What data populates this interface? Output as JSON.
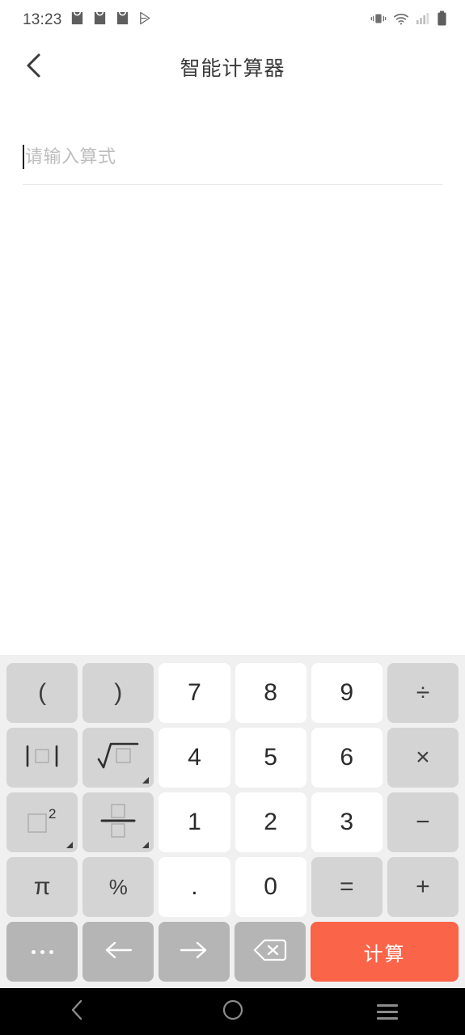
{
  "statusbar": {
    "clock": "13:23",
    "left_icons": [
      "mail-icon",
      "mail-icon",
      "mail-icon",
      "play-store-icon"
    ],
    "right_icons": [
      "vibrate-icon",
      "wifi-icon",
      "signal-bars-icon",
      "battery-icon"
    ]
  },
  "appbar": {
    "back_icon": "chevron-left-icon",
    "title": "智能计算器"
  },
  "input": {
    "value": "",
    "placeholder": "请输入算式"
  },
  "colors": {
    "accent": "#fa6449",
    "function_key": "#d4d4d4",
    "number_key": "#ffffff",
    "util_key": "#b5b5b5",
    "keypad_bg": "#f0f0f0",
    "navbar_bg": "#000000"
  },
  "keypad": {
    "rows": [
      [
        {
          "name": "key-open-paren",
          "label": "(",
          "type": "fn",
          "glyph": "text"
        },
        {
          "name": "key-close-paren",
          "label": ")",
          "type": "fn",
          "glyph": "text"
        },
        {
          "name": "key-7",
          "label": "7",
          "type": "num",
          "glyph": "text"
        },
        {
          "name": "key-8",
          "label": "8",
          "type": "num",
          "glyph": "text"
        },
        {
          "name": "key-9",
          "label": "9",
          "type": "num",
          "glyph": "text"
        },
        {
          "name": "key-divide",
          "label": "÷",
          "type": "fn",
          "glyph": "text"
        }
      ],
      [
        {
          "name": "key-absolute-value",
          "label": "|□|",
          "type": "fn",
          "glyph": "abs"
        },
        {
          "name": "key-square-root",
          "label": "√□",
          "type": "fn",
          "glyph": "sqrt",
          "more": true
        },
        {
          "name": "key-4",
          "label": "4",
          "type": "num",
          "glyph": "text"
        },
        {
          "name": "key-5",
          "label": "5",
          "type": "num",
          "glyph": "text"
        },
        {
          "name": "key-6",
          "label": "6",
          "type": "num",
          "glyph": "text"
        },
        {
          "name": "key-multiply",
          "label": "×",
          "type": "fn",
          "glyph": "text"
        }
      ],
      [
        {
          "name": "key-square",
          "label": "□²",
          "type": "fn",
          "glyph": "square",
          "more": true
        },
        {
          "name": "key-fraction",
          "label": "□/□",
          "type": "fn",
          "glyph": "fraction",
          "more": true
        },
        {
          "name": "key-1",
          "label": "1",
          "type": "num",
          "glyph": "text"
        },
        {
          "name": "key-2",
          "label": "2",
          "type": "num",
          "glyph": "text"
        },
        {
          "name": "key-3",
          "label": "3",
          "type": "num",
          "glyph": "text"
        },
        {
          "name": "key-minus",
          "label": "−",
          "type": "fn",
          "glyph": "text"
        }
      ],
      [
        {
          "name": "key-pi",
          "label": "π",
          "type": "fn",
          "glyph": "text"
        },
        {
          "name": "key-percent",
          "label": "%",
          "type": "fn",
          "glyph": "text"
        },
        {
          "name": "key-decimal",
          "label": ".",
          "type": "num",
          "glyph": "text"
        },
        {
          "name": "key-0",
          "label": "0",
          "type": "num",
          "glyph": "text"
        },
        {
          "name": "key-equals",
          "label": "=",
          "type": "fn",
          "glyph": "text"
        },
        {
          "name": "key-plus",
          "label": "+",
          "type": "fn",
          "glyph": "text"
        }
      ],
      [
        {
          "name": "key-more",
          "label": "...",
          "type": "util",
          "glyph": "ellipsis"
        },
        {
          "name": "key-cursor-left",
          "label": "←",
          "type": "util",
          "glyph": "arrow-left"
        },
        {
          "name": "key-cursor-right",
          "label": "→",
          "type": "util",
          "glyph": "arrow-right"
        },
        {
          "name": "key-backspace",
          "label": "⌫",
          "type": "util",
          "glyph": "backspace"
        },
        {
          "name": "key-calculate",
          "label": "计算",
          "type": "calc",
          "glyph": "text"
        }
      ]
    ]
  },
  "navbar": {
    "back": "back-icon",
    "home": "home-icon",
    "recents": "recents-icon"
  }
}
